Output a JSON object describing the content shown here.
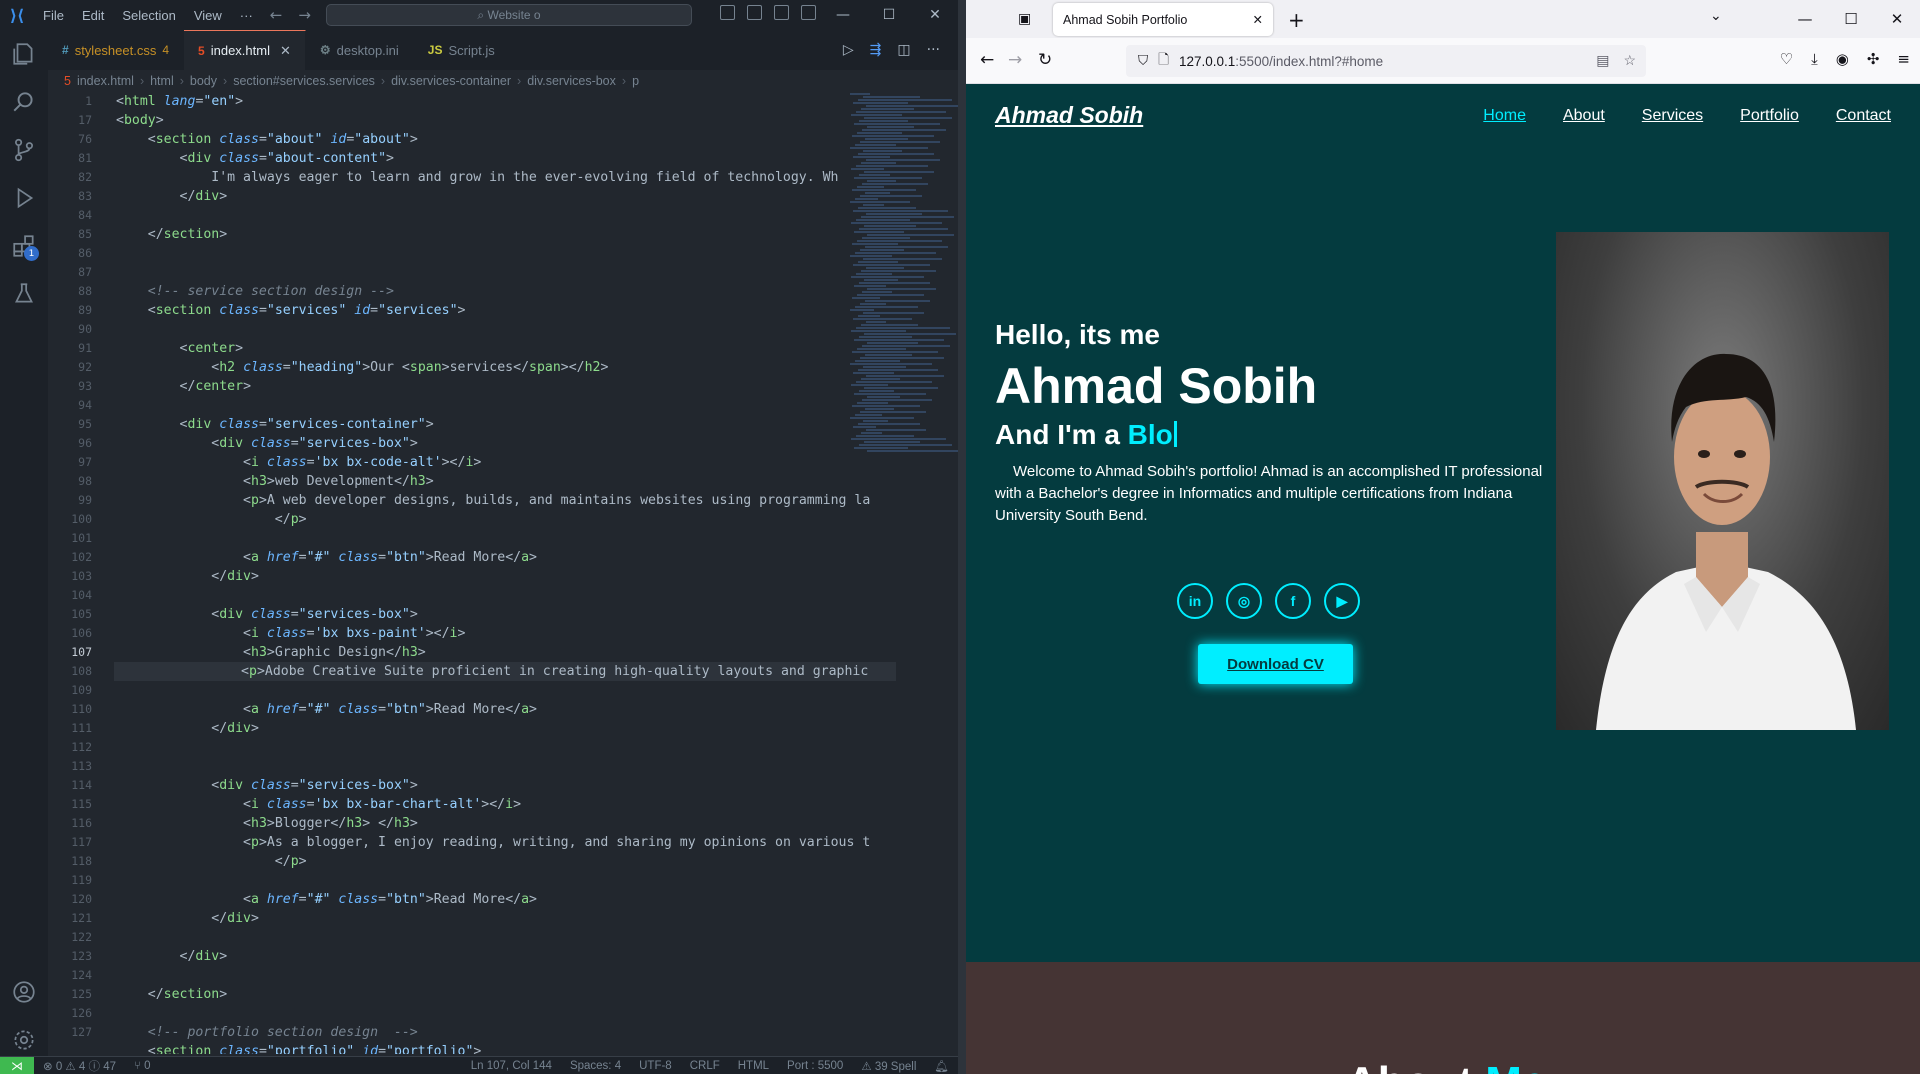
{
  "vscode": {
    "menu": [
      "File",
      "Edit",
      "Selection",
      "View",
      "···"
    ],
    "search_placeholder": "Website o",
    "tabs": [
      {
        "label": "stylesheet.css",
        "mod": "4",
        "icon": "#",
        "icon_color": "#519aba"
      },
      {
        "label": "index.html",
        "mod": "",
        "icon": "5",
        "icon_color": "#e44d26"
      },
      {
        "label": "desktop.ini",
        "mod": "",
        "icon": "⚙",
        "icon_color": "#6d8086"
      },
      {
        "label": "Script.js",
        "mod": "",
        "icon": "JS",
        "icon_color": "#cbcb41"
      }
    ],
    "breadcrumb": [
      "index.html",
      "html",
      "body",
      "section#services.services",
      "div.services-container",
      "div.services-box",
      "p"
    ],
    "line_numbers": [
      "1",
      "17",
      "76",
      "81",
      "82",
      "83",
      "84",
      "85",
      "86",
      "87",
      "88",
      "89",
      "90",
      "91",
      "92",
      "93",
      "94",
      "95",
      "96",
      "97",
      "98",
      "99",
      "100",
      "101",
      "102",
      "103",
      "104",
      "105",
      "106",
      "107",
      "108",
      "109",
      "110",
      "111",
      "112",
      "113",
      "114",
      "115",
      "116",
      "117",
      "118",
      "119",
      "120",
      "121",
      "122",
      "123",
      "124",
      "125",
      "126",
      "127"
    ],
    "current_line": "107",
    "status": {
      "problems": "⊗ 0 ⚠ 4 ⓘ 47",
      "ports": "⑂ 0",
      "position": "Ln 107, Col 144",
      "spaces": "Spaces: 4",
      "encoding": "UTF-8",
      "eol": "CRLF",
      "language": "HTML",
      "port": "Port : 5500",
      "spell": "⚠ 39 Spell"
    }
  },
  "browser": {
    "tab_title": "Ahmad Sobih Portfolio",
    "url_host": "127.0.0.1",
    "url_path": ":5500/index.html?#home"
  },
  "page": {
    "logo": "Ahmad Sobih",
    "nav": [
      "Home",
      "About",
      "Services",
      "Portfolio",
      "Contact"
    ],
    "greeting": "Hello, its me",
    "name": "Ahmad Sobih",
    "role_prefix": "And I'm a ",
    "role_typed": "Blo",
    "description_1": "Welcome to Ahmad Sobih's portfolio! Ahmad is an accomplished IT professional",
    "description_2": "with a Bachelor's degree in Informatics and multiple certifications from Indiana University South Bend.",
    "socials": [
      "in",
      "◎",
      "f",
      "▶"
    ],
    "cv_button": "Download CV",
    "about_title_1": "About ",
    "about_title_2": "Me",
    "accent_color": "#00eeff",
    "bg_color": "#043b3f"
  }
}
